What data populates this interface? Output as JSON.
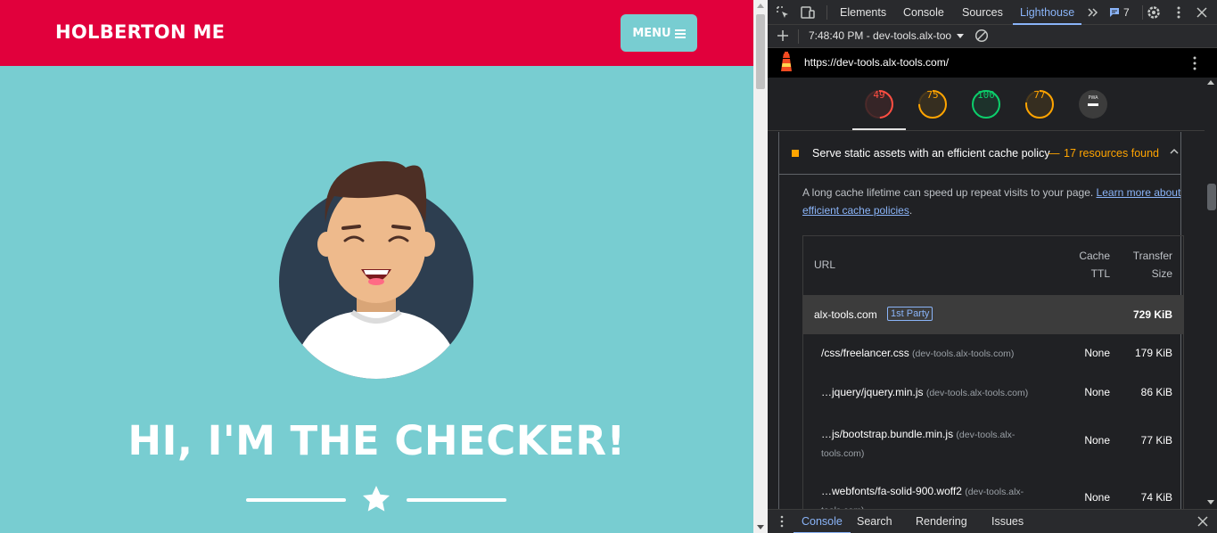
{
  "site": {
    "brand": "HOLBERTON ME",
    "menu_label": "MENU",
    "hero_title": "HI, I'M THE CHECKER!",
    "colors": {
      "nav": "#e1003c",
      "background": "#78cdd1"
    }
  },
  "devtools": {
    "tabs": [
      "Elements",
      "Console",
      "Sources",
      "Lighthouse"
    ],
    "active_tab": "Lighthouse",
    "issues_count": "7",
    "report_select": "7:48:40 PM - dev-tools.alx-too",
    "url": "https://dev-tools.alx-tools.com/",
    "gauges": [
      {
        "label": "49",
        "score": 49,
        "color": "#ff4e42"
      },
      {
        "label": "75",
        "score": 75,
        "color": "#ffa400"
      },
      {
        "label": "100",
        "score": 100,
        "color": "#0cce6b"
      },
      {
        "label": "77",
        "score": 77,
        "color": "#ffa400"
      },
      {
        "label": "PWA",
        "icon": "pwa-dash-icon"
      }
    ],
    "audit": {
      "title": "Serve static assets with an efficient cache policy",
      "separator": "—",
      "count": "17 resources found",
      "desc_text": "A long cache lifetime can speed up repeat visits to your page.",
      "desc_link": "Learn more about efficient cache policies",
      "desc_end": ".",
      "table": {
        "headers": {
          "url": "URL",
          "cache_ttl": "Cache TTL",
          "transfer_size": "Transfer Size"
        },
        "group": {
          "name": "alx-tools.com",
          "badge": "1st Party",
          "size": "729 KiB"
        },
        "rows": [
          {
            "path": "/css/freelancer.css",
            "host": "(dev-tools.alx-tools.com)",
            "ttl": "None",
            "size": "179 KiB"
          },
          {
            "path": "…jquery/jquery.min.js",
            "host": "(dev-tools.alx-tools.com)",
            "ttl": "None",
            "size": "86 KiB"
          },
          {
            "path": "…js/bootstrap.bundle.min.js",
            "host": "(dev-tools.alx-tools.com)",
            "ttl": "None",
            "size": "77 KiB"
          },
          {
            "path": "…webfonts/fa-solid-900.woff2",
            "host": "(dev-tools.alx-tools.com)",
            "ttl": "None",
            "size": "74 KiB"
          }
        ]
      }
    },
    "drawer_tabs": [
      "Console",
      "Search",
      "Rendering",
      "Issues"
    ]
  }
}
